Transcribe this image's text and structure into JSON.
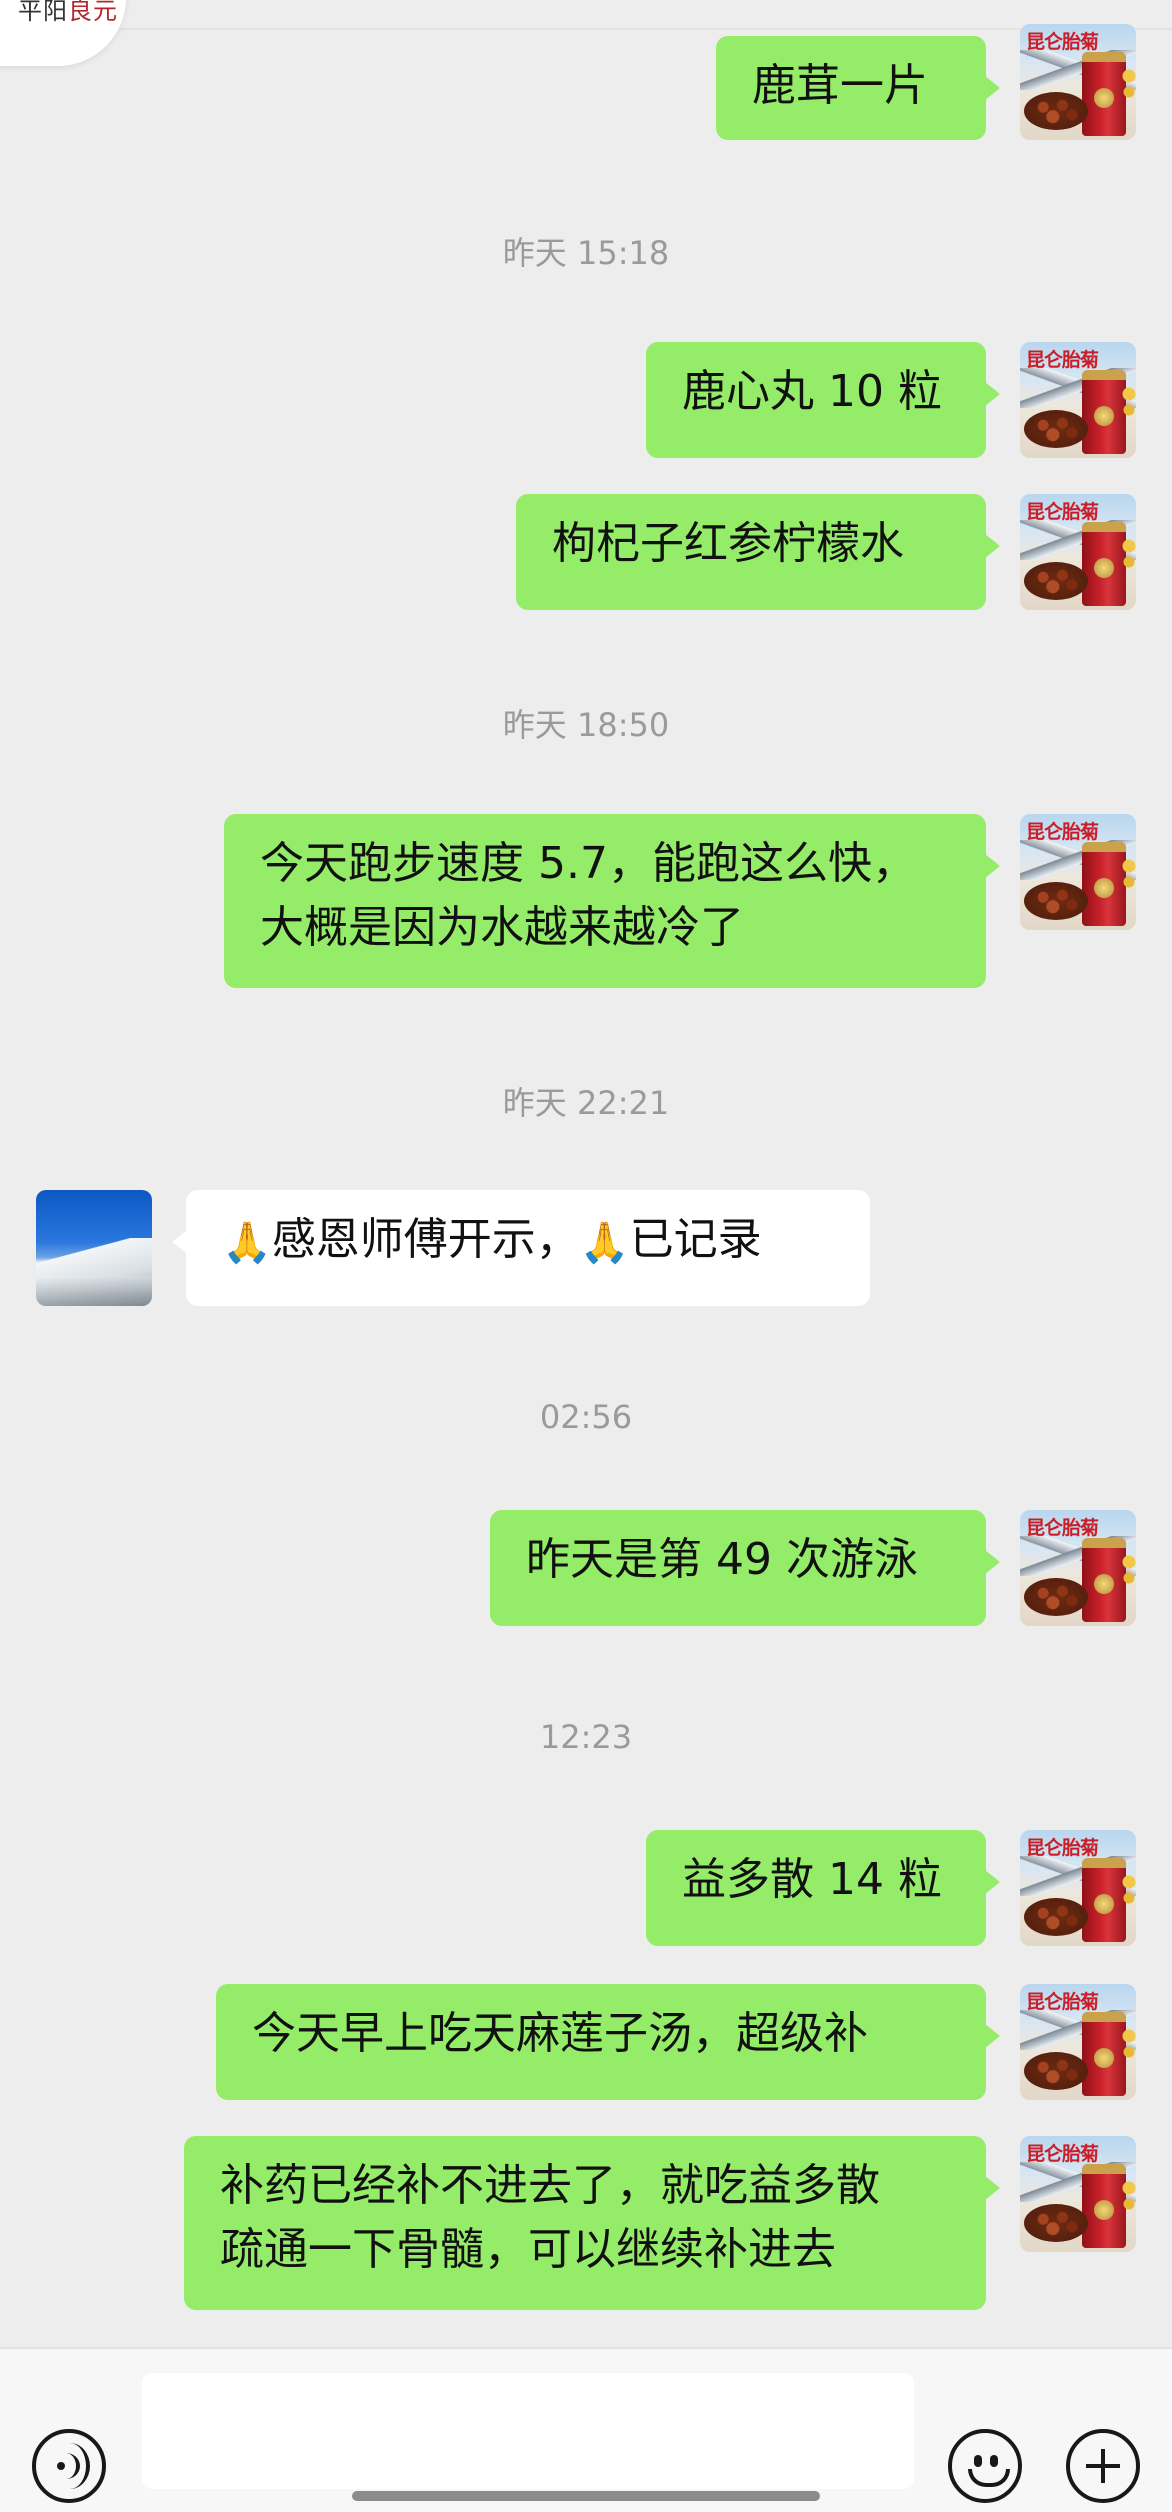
{
  "header": {
    "badge_text_a": "平阳",
    "badge_text_b": "良元"
  },
  "avatars": {
    "self_title": "昆仑胎菊",
    "self_icon": "product-tin-avatar",
    "other_icon": "snowy-mountain-avatar"
  },
  "colors": {
    "outgoing_bubble": "#95ec69",
    "incoming_bubble": "#ffffff",
    "background": "#ededed"
  },
  "messages": {
    "m1": "鹿茸一片",
    "t1": "昨天 15:18",
    "m2": "鹿心丸 10 粒",
    "m3": "枸杞子红参柠檬水",
    "t2": "昨天 18:50",
    "m4_line1": "今天跑步速度 5.7，能跑这么快，",
    "m4_line2": "大概是因为水越来越冷了",
    "t3": "昨天 22:21",
    "m5_emoji": "🙏",
    "m5_text1": "感恩师傅开示，",
    "m5_text2": "已记录",
    "t4": "02:56",
    "m6": "昨天是第 49 次游泳",
    "t5": "12:23",
    "m7": "益多散 14 粒",
    "m8": "今天早上吃天麻莲子汤，超级补",
    "m9_line1": "补药已经补不进去了，就吃益多散",
    "m9_line2": "疏通一下骨髓，可以继续补进去"
  },
  "input_bar": {
    "voice_icon": "voice-icon",
    "emoji_icon": "emoji-icon",
    "plus_icon": "plus-icon",
    "text_value": ""
  }
}
